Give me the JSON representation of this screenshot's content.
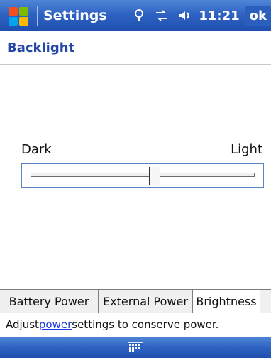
{
  "window": {
    "app_title": "Settings",
    "clock": "11:21",
    "ok_label": "ok",
    "icons": [
      "windows-start-icon",
      "signal-icon",
      "sync-icon",
      "speaker-icon"
    ]
  },
  "page": {
    "title": "Backlight"
  },
  "slider": {
    "left_label": "Dark",
    "right_label": "Light",
    "level_fraction": 0.55
  },
  "tabs": [
    {
      "label": "Battery Power",
      "active": false
    },
    {
      "label": "External Power",
      "active": false
    },
    {
      "label": "Brightness",
      "active": true
    }
  ],
  "hint": {
    "prefix": "Adjust ",
    "link": "power",
    "suffix": " settings to conserve power."
  },
  "bottom": {
    "icon": "keyboard-icon"
  }
}
